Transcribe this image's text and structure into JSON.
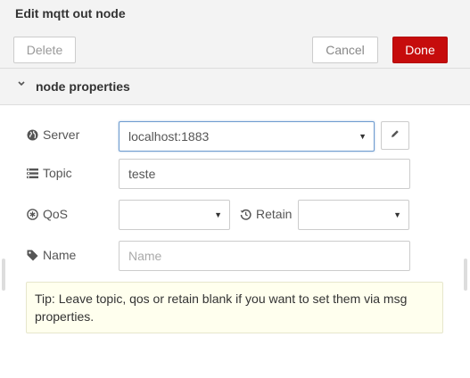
{
  "dialog": {
    "title": "Edit mqtt out node"
  },
  "toolbar": {
    "delete_label": "Delete",
    "cancel_label": "Cancel",
    "done_label": "Done"
  },
  "section": {
    "title": "node properties",
    "chevron_icon": "chevron-down-icon"
  },
  "form": {
    "server": {
      "label": "Server",
      "icon": "globe-icon",
      "value": "localhost:1883",
      "edit_icon": "pencil-icon"
    },
    "topic": {
      "label": "Topic",
      "icon": "list-icon",
      "value": "teste"
    },
    "qos": {
      "label": "QoS",
      "icon": "asterisk-circle-icon",
      "value": ""
    },
    "retain": {
      "label": "Retain",
      "icon": "history-icon",
      "value": ""
    },
    "name": {
      "label": "Name",
      "icon": "tag-icon",
      "value": "",
      "placeholder": "Name"
    }
  },
  "tip": {
    "text": "Tip: Leave topic, qos or retain blank if you want to set them via msg properties."
  },
  "colors": {
    "accent": "#c60c0c",
    "header_bg": "#f3f3f3",
    "tip_bg": "#ffffee",
    "focus_border": "#6e9ccf"
  }
}
